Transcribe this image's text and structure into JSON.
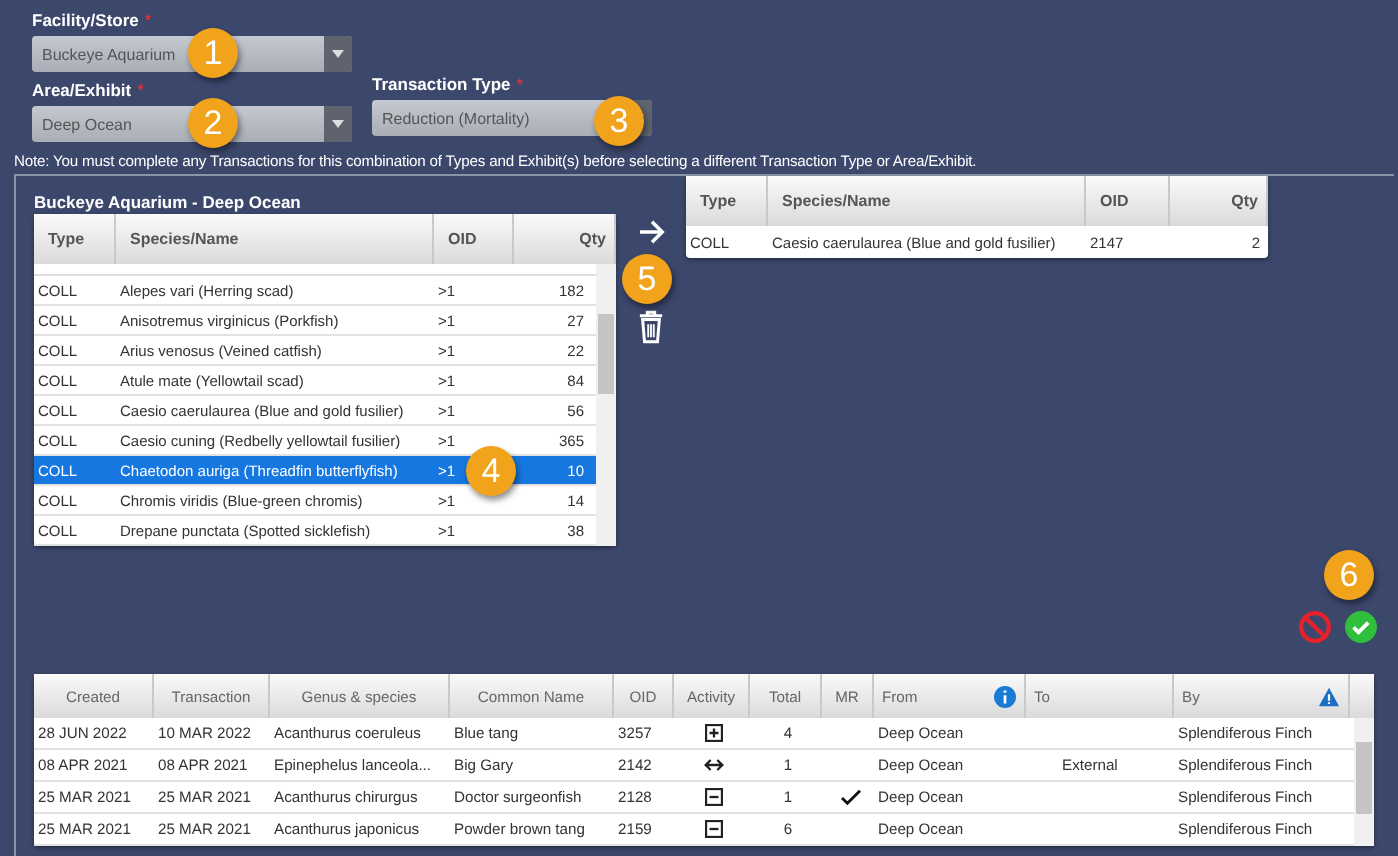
{
  "filters": [
    {
      "label": "Facility/Store",
      "required_mark": "*",
      "value": "Buckeye Aquarium",
      "callout": "1"
    },
    {
      "label": "Area/Exhibit",
      "required_mark": "*",
      "value": "Deep Ocean",
      "callout": "2"
    },
    {
      "label": "Transaction Type",
      "required_mark": "*",
      "value": "Reduction (Mortality)",
      "callout": "3"
    }
  ],
  "note": "Note: You must complete any Transactions for this combination of Types and Exhibit(s) before selecting a different Transaction Type or Area/Exhibit.",
  "source_table": {
    "title": "Buckeye Aquarium - Deep Ocean",
    "columns": [
      "Type",
      "Species/Name",
      "OID",
      "Qty"
    ],
    "rows": [
      {
        "type": "COLL",
        "name": "Alepes vari (Herring scad)",
        "oid": ">1",
        "qty": "182",
        "selected": false
      },
      {
        "type": "COLL",
        "name": "Anisotremus virginicus (Porkfish)",
        "oid": ">1",
        "qty": "27",
        "selected": false
      },
      {
        "type": "COLL",
        "name": "Arius venosus (Veined catfish)",
        "oid": ">1",
        "qty": "22",
        "selected": false
      },
      {
        "type": "COLL",
        "name": "Atule mate (Yellowtail scad)",
        "oid": ">1",
        "qty": "84",
        "selected": false
      },
      {
        "type": "COLL",
        "name": "Caesio caerulaurea (Blue and gold fusilier)",
        "oid": ">1",
        "qty": "56",
        "selected": false
      },
      {
        "type": "COLL",
        "name": "Caesio cuning (Redbelly yellowtail fusilier)",
        "oid": ">1",
        "qty": "365",
        "selected": false
      },
      {
        "type": "COLL",
        "name": "Chaetodon auriga (Threadfin butterflyfish)",
        "oid": ">1",
        "qty": "10",
        "selected": true,
        "callout": "4"
      },
      {
        "type": "COLL",
        "name": "Chromis viridis (Blue-green chromis)",
        "oid": ">1",
        "qty": "14",
        "selected": false
      },
      {
        "type": "COLL",
        "name": "Drepane punctata (Spotted sicklefish)",
        "oid": ">1",
        "qty": "38",
        "selected": false
      }
    ]
  },
  "move_callout": "5",
  "target_table": {
    "columns": [
      "Type",
      "Species/Name",
      "OID",
      "Qty"
    ],
    "rows": [
      {
        "type": "COLL",
        "name": "Caesio caerulaurea (Blue and gold fusilier)",
        "oid": "2147",
        "qty": "2"
      }
    ]
  },
  "actions_callout": "6",
  "history_table": {
    "columns": [
      "Created",
      "Transaction",
      "Genus & species",
      "Common Name",
      "OID",
      "Activity",
      "Total",
      "MR",
      "From",
      "To",
      "By"
    ],
    "rows": [
      {
        "created": "28 JUN 2022",
        "transaction": "10 MAR 2022",
        "genus": "Acanthurus coeruleus",
        "common": "Blue tang",
        "oid": "3257",
        "kind": "add",
        "total": "4",
        "mr": false,
        "from": "Deep Ocean",
        "by": "Splendiferous Finch"
      },
      {
        "created": "08 APR 2021",
        "transaction": "08 APR 2021",
        "genus": "Epinephelus lanceola...",
        "common": "Big Gary",
        "oid": "2142",
        "kind": "transfer",
        "total": "1",
        "mr": false,
        "from": "Deep Ocean",
        "to": "External",
        "by": "Splendiferous Finch"
      },
      {
        "created": "25 MAR 2021",
        "transaction": "25 MAR 2021",
        "genus": "Acanthurus chirurgus",
        "common": "Doctor surgeonfish",
        "oid": "2128",
        "kind": "reduce",
        "total": "1",
        "mr": true,
        "from": "Deep Ocean",
        "by": "Splendiferous Finch"
      },
      {
        "created": "25 MAR 2021",
        "transaction": "25 MAR 2021",
        "genus": "Acanthurus japonicus",
        "common": "Powder brown tang",
        "oid": "2159",
        "kind": "reduce",
        "total": "6",
        "mr": false,
        "from": "Deep Ocean",
        "by": "Splendiferous Finch"
      }
    ]
  }
}
